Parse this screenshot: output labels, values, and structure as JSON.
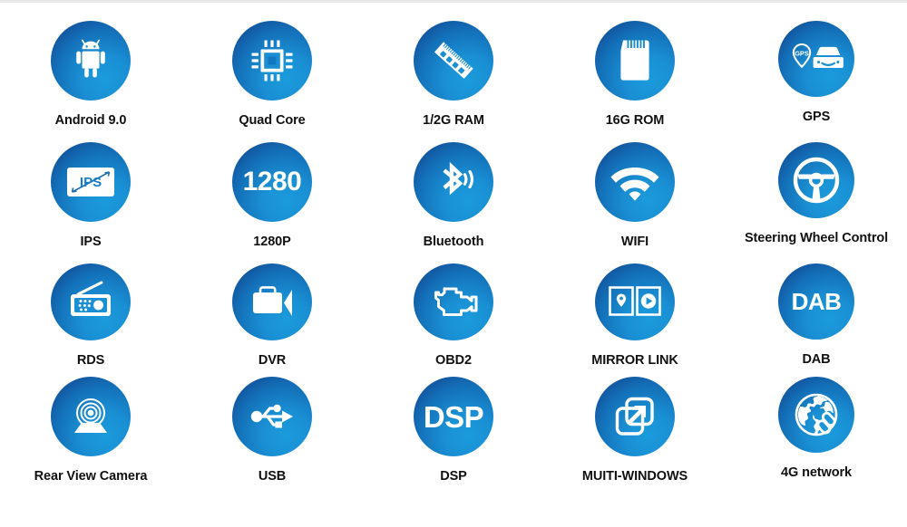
{
  "page": {
    "title": "Car Stereo Feature Specification Grid",
    "background_color": "#ffffff",
    "label_color": "#111111",
    "badge_gradient_from": "#1a9bdc",
    "badge_gradient_to": "#123f86",
    "columns": 5,
    "rows": 4
  },
  "features": [
    {
      "label": "Android 9.0",
      "icon": "android-robot-icon",
      "badge_text": ""
    },
    {
      "label": "Quad Core",
      "icon": "cpu-chip-icon",
      "badge_text": ""
    },
    {
      "label": "1/2G RAM",
      "icon": "ram-memory-stick-icon",
      "badge_text": ""
    },
    {
      "label": "16G ROM",
      "icon": "sd-card-icon",
      "badge_text": ""
    },
    {
      "label": "GPS",
      "icon": "gps-car-navigation-icon",
      "badge_text": "GPS"
    },
    {
      "label": "IPS",
      "icon": "ips-display-icon",
      "badge_text": "IPS"
    },
    {
      "label": "1280P",
      "icon": "resolution-text-icon",
      "badge_text": "1280"
    },
    {
      "label": "Bluetooth",
      "icon": "bluetooth-icon",
      "badge_text": ""
    },
    {
      "label": "WIFI",
      "icon": "wifi-icon",
      "badge_text": ""
    },
    {
      "label": "Steering Wheel Control",
      "icon": "steering-wheel-icon",
      "badge_text": ""
    },
    {
      "label": "RDS",
      "icon": "radio-icon",
      "badge_text": ""
    },
    {
      "label": "DVR",
      "icon": "video-camera-icon",
      "badge_text": ""
    },
    {
      "label": "OBD2",
      "icon": "check-engine-icon",
      "badge_text": ""
    },
    {
      "label": "MIRROR LINK",
      "icon": "mirror-link-screens-icon",
      "badge_text": ""
    },
    {
      "label": "DAB",
      "icon": "dab-text-icon",
      "badge_text": "DAB"
    },
    {
      "label": "Rear View Camera",
      "icon": "rear-view-camera-icon",
      "badge_text": ""
    },
    {
      "label": "USB",
      "icon": "usb-icon",
      "badge_text": ""
    },
    {
      "label": "DSP",
      "icon": "dsp-text-icon",
      "badge_text": "DSP"
    },
    {
      "label": "MUITI-WINDOWS",
      "icon": "multi-windows-icon",
      "badge_text": ""
    },
    {
      "label": "4G network",
      "icon": "globe-network-icon",
      "badge_text": ""
    }
  ]
}
